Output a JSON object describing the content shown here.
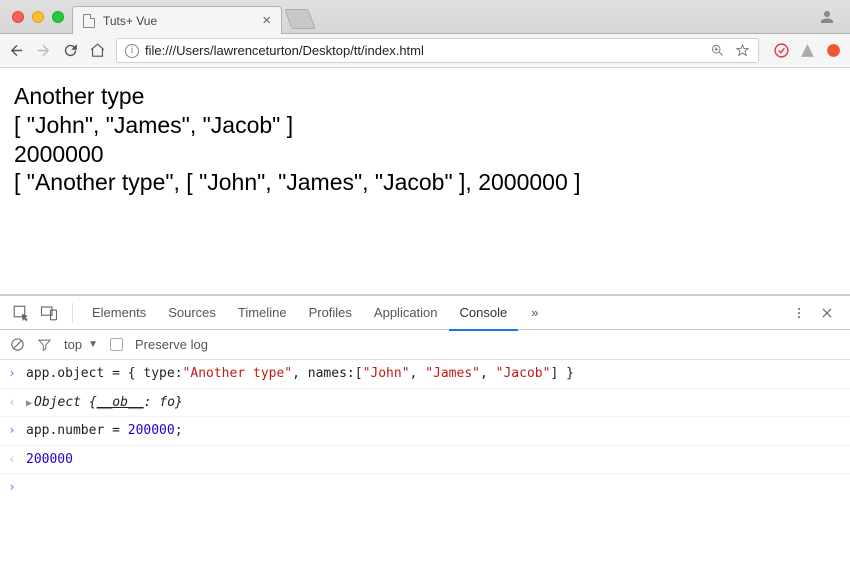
{
  "tab": {
    "title": "Tuts+ Vue"
  },
  "address": {
    "url": "file:///Users/lawrenceturton/Desktop/tt/index.html"
  },
  "page": {
    "line1": "Another type",
    "line2": "[ \"John\", \"James\", \"Jacob\" ]",
    "line3": "2000000",
    "line4": "[ \"Another type\", [ \"John\", \"James\", \"Jacob\" ], 2000000 ]"
  },
  "devtools": {
    "tabs": [
      "Elements",
      "Sources",
      "Timeline",
      "Profiles",
      "Application",
      "Console"
    ],
    "active_tab": "Console",
    "overflow": "»"
  },
  "console_toolbar": {
    "context": "top",
    "preserve_log_label": "Preserve log"
  },
  "console": {
    "entries": [
      {
        "type": "input",
        "segments": [
          {
            "t": "app.object = { type:",
            "c": "kw"
          },
          {
            "t": "\"Another type\"",
            "c": "str"
          },
          {
            "t": ", names:[",
            "c": "kw"
          },
          {
            "t": "\"John\"",
            "c": "str"
          },
          {
            "t": ", ",
            "c": "kw"
          },
          {
            "t": "\"James\"",
            "c": "str"
          },
          {
            "t": ", ",
            "c": "kw"
          },
          {
            "t": "\"Jacob\"",
            "c": "str"
          },
          {
            "t": "] }",
            "c": "kw"
          }
        ]
      },
      {
        "type": "output",
        "expandable": true,
        "segments": [
          {
            "t": "Object {",
            "c": "obj"
          },
          {
            "t": "__ob__",
            "c": "obj",
            "u": true
          },
          {
            "t": ": fo}",
            "c": "obj"
          }
        ]
      },
      {
        "type": "input",
        "segments": [
          {
            "t": "app.number = ",
            "c": "kw"
          },
          {
            "t": "200000",
            "c": "num"
          },
          {
            "t": ";",
            "c": "kw"
          }
        ]
      },
      {
        "type": "output",
        "segments": [
          {
            "t": "200000",
            "c": "num"
          }
        ]
      },
      {
        "type": "prompt",
        "segments": []
      }
    ]
  }
}
